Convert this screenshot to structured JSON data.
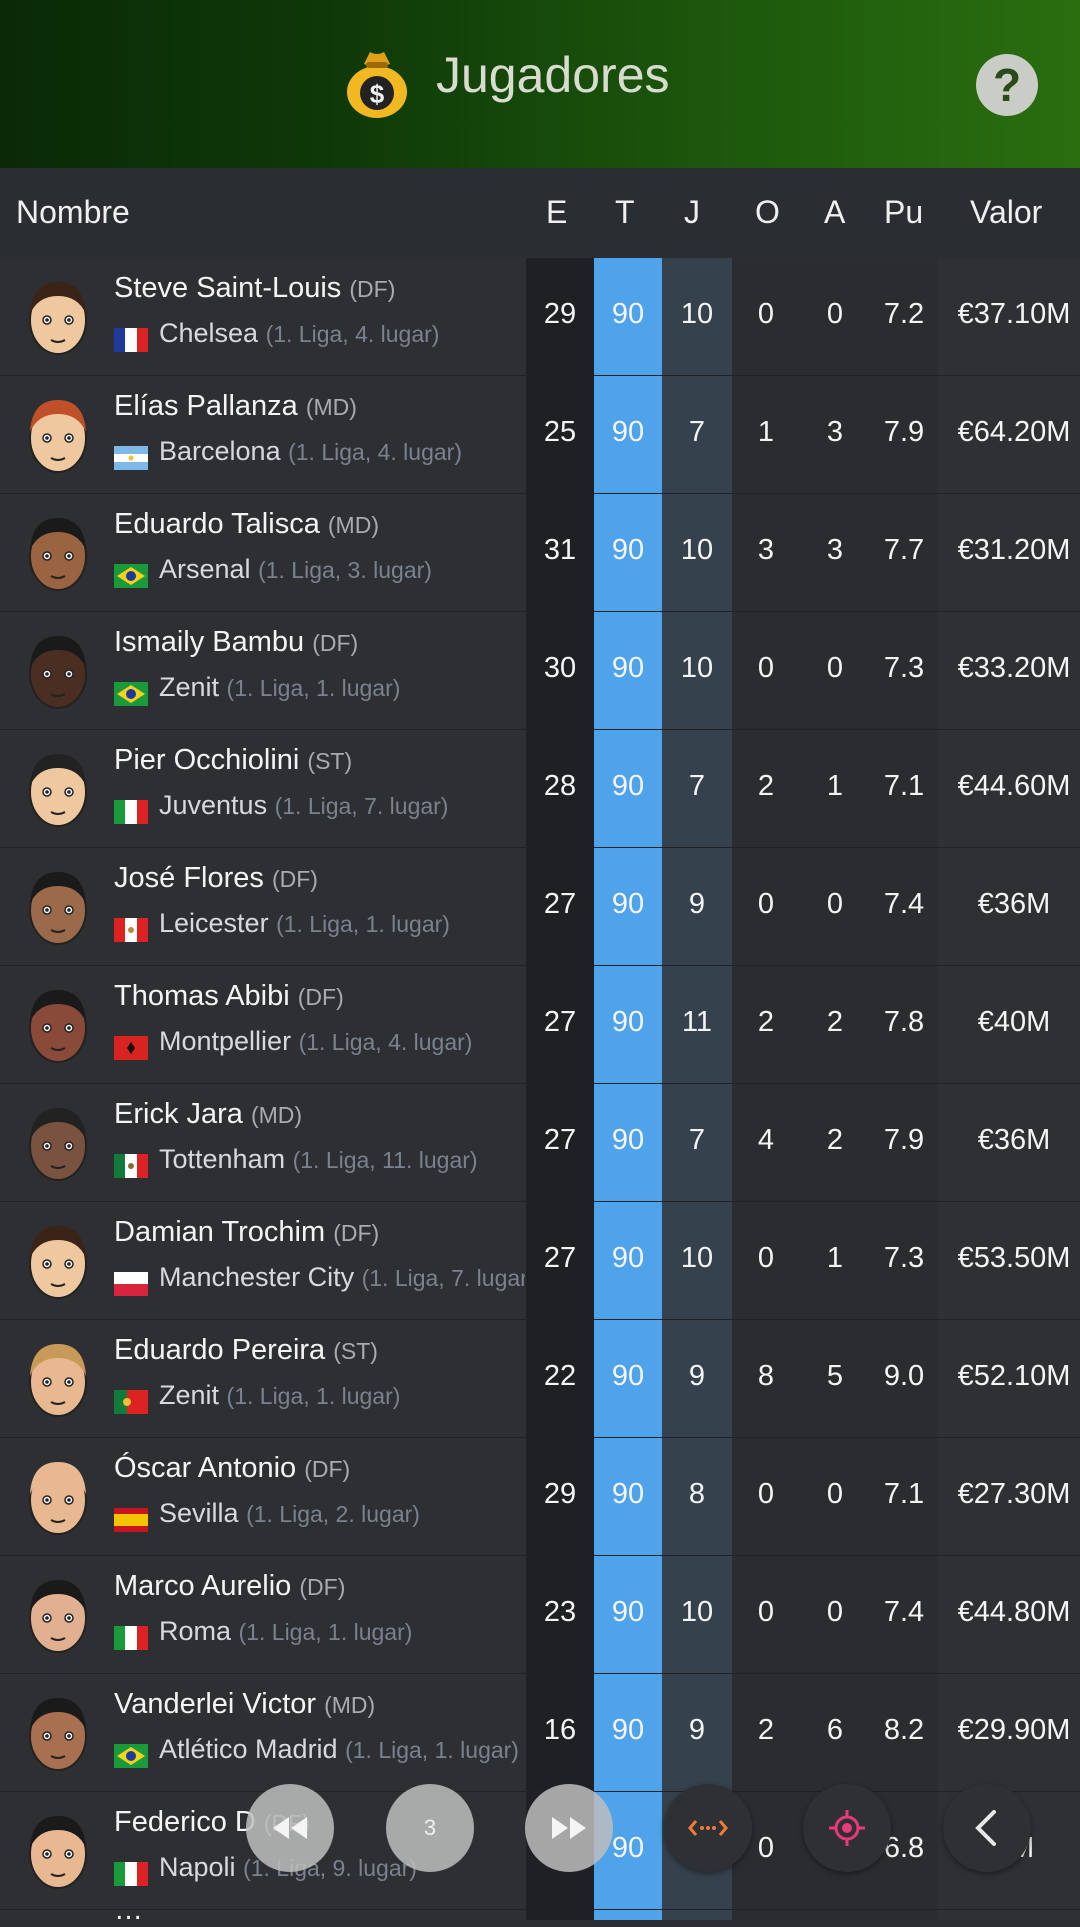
{
  "header": {
    "title": "Jugadores",
    "help_label": "?"
  },
  "columns": {
    "name": "Nombre",
    "e": "E",
    "t": "T",
    "j": "J",
    "o": "O",
    "a": "A",
    "pu": "Pu",
    "valor": "Valor"
  },
  "players": [
    {
      "name": "Steve Saint-Louis",
      "pos": "(DF)",
      "club": "Chelsea",
      "league": "(1. Liga, 4. lugar)",
      "flag": "france",
      "e": "29",
      "t": "90",
      "j": "10",
      "o": "0",
      "a": "0",
      "pu": "7.2",
      "valor": "€37.10M"
    },
    {
      "name": "Elías Pallanza",
      "pos": "(MD)",
      "club": "Barcelona",
      "league": "(1. Liga, 4. lugar)",
      "flag": "argentina",
      "e": "25",
      "t": "90",
      "j": "7",
      "o": "1",
      "a": "3",
      "pu": "7.9",
      "valor": "€64.20M"
    },
    {
      "name": "Eduardo Talisca",
      "pos": "(MD)",
      "club": "Arsenal",
      "league": "(1. Liga, 3. lugar)",
      "flag": "brazil",
      "e": "31",
      "t": "90",
      "j": "10",
      "o": "3",
      "a": "3",
      "pu": "7.7",
      "valor": "€31.20M"
    },
    {
      "name": "Ismaily Bambu",
      "pos": "(DF)",
      "club": "Zenit",
      "league": "(1. Liga, 1. lugar)",
      "flag": "brazil",
      "e": "30",
      "t": "90",
      "j": "10",
      "o": "0",
      "a": "0",
      "pu": "7.3",
      "valor": "€33.20M"
    },
    {
      "name": "Pier Occhiolini",
      "pos": "(ST)",
      "club": "Juventus",
      "league": "(1. Liga, 7. lugar)",
      "flag": "italy",
      "e": "28",
      "t": "90",
      "j": "7",
      "o": "2",
      "a": "1",
      "pu": "7.1",
      "valor": "€44.60M"
    },
    {
      "name": "José Flores",
      "pos": "(DF)",
      "club": "Leicester",
      "league": "(1. Liga, 1. lugar)",
      "flag": "peru",
      "e": "27",
      "t": "90",
      "j": "9",
      "o": "0",
      "a": "0",
      "pu": "7.4",
      "valor": "€36M"
    },
    {
      "name": "Thomas Abibi",
      "pos": "(DF)",
      "club": "Montpellier",
      "league": "(1. Liga, 4. lugar)",
      "flag": "albania",
      "e": "27",
      "t": "90",
      "j": "11",
      "o": "2",
      "a": "2",
      "pu": "7.8",
      "valor": "€40M"
    },
    {
      "name": "Erick Jara",
      "pos": "(MD)",
      "club": "Tottenham",
      "league": "(1. Liga, 11. lugar)",
      "flag": "mexico",
      "e": "27",
      "t": "90",
      "j": "7",
      "o": "4",
      "a": "2",
      "pu": "7.9",
      "valor": "€36M"
    },
    {
      "name": "Damian Trochim",
      "pos": "(DF)",
      "club": "Manchester City",
      "league": "(1. Liga, 7. lugar)",
      "flag": "poland",
      "e": "27",
      "t": "90",
      "j": "10",
      "o": "0",
      "a": "1",
      "pu": "7.3",
      "valor": "€53.50M"
    },
    {
      "name": "Eduardo Pereira",
      "pos": "(ST)",
      "club": "Zenit",
      "league": "(1. Liga, 1. lugar)",
      "flag": "portugal",
      "e": "22",
      "t": "90",
      "j": "9",
      "o": "8",
      "a": "5",
      "pu": "9.0",
      "valor": "€52.10M"
    },
    {
      "name": "Óscar Antonio",
      "pos": "(DF)",
      "club": "Sevilla",
      "league": "(1. Liga, 2. lugar)",
      "flag": "spain",
      "e": "29",
      "t": "90",
      "j": "8",
      "o": "0",
      "a": "0",
      "pu": "7.1",
      "valor": "€27.30M"
    },
    {
      "name": "Marco Aurelio",
      "pos": "(DF)",
      "club": "Roma",
      "league": "(1. Liga, 1. lugar)",
      "flag": "italy",
      "e": "23",
      "t": "90",
      "j": "10",
      "o": "0",
      "a": "0",
      "pu": "7.4",
      "valor": "€44.80M"
    },
    {
      "name": "Vanderlei Victor",
      "pos": "(MD)",
      "club": "Atlético Madrid",
      "league": "(1. Liga, 1. lugar)",
      "flag": "brazil",
      "e": "16",
      "t": "90",
      "j": "9",
      "o": "2",
      "a": "6",
      "pu": "8.2",
      "valor": "€29.90M"
    },
    {
      "name": "Federico D",
      "pos": "(DF)",
      "club": "Napoli",
      "league": "(1. Liga, 9. lugar)",
      "flag": "italy",
      "e": "",
      "t": "90",
      "j": "",
      "o": "0",
      "a": "",
      "pu": "6.8",
      "valor": "0M"
    }
  ],
  "controls": {
    "rewind_icon": "rewind-icon",
    "page_label": "3",
    "forward_icon": "fast-forward-icon",
    "swap_icon": "horizontal-arrows-icon",
    "target_icon": "target-icon",
    "back_icon": "chevron-left-icon"
  },
  "colors": {
    "t_column": "#4ea3ea",
    "j_column": "#35414c",
    "e_column": "#1f2023",
    "accent_orange": "#f07a3a",
    "accent_pink": "#e83a7a"
  }
}
